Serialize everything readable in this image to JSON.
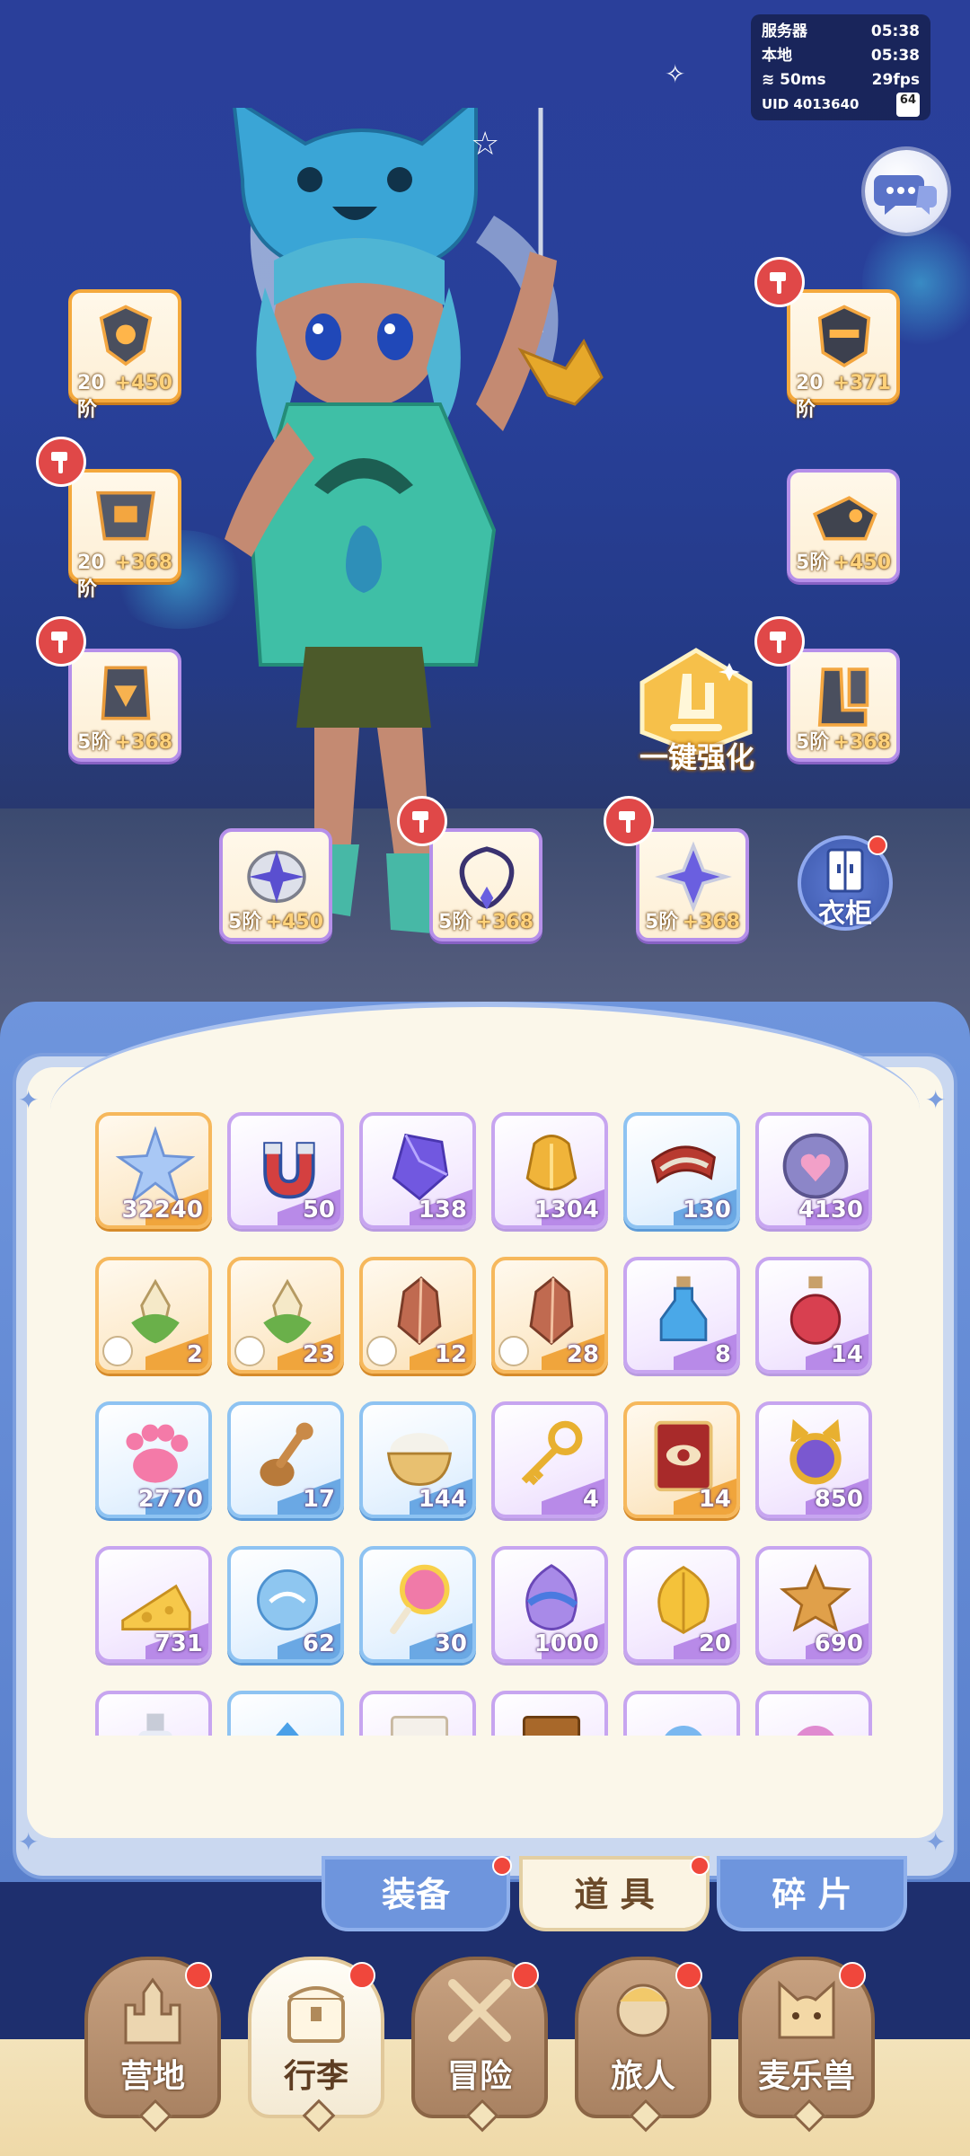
{
  "status": {
    "server_label": "服务器",
    "server_time": "05:38",
    "local_label": "本地",
    "local_time": "05:38",
    "ping": "50ms",
    "fps": "29fps",
    "uid": "UID 4013640",
    "battery": "64"
  },
  "equipment": [
    {
      "slot": "left-1",
      "tier": "20阶",
      "bonus": "+450",
      "upgradable": false
    },
    {
      "slot": "left-2",
      "tier": "20阶",
      "bonus": "+368",
      "upgradable": true
    },
    {
      "slot": "left-3",
      "tier": "5阶",
      "bonus": "+368",
      "upgradable": true
    },
    {
      "slot": "bottom-1",
      "tier": "5阶",
      "bonus": "+450",
      "upgradable": false
    },
    {
      "slot": "bottom-2",
      "tier": "5阶",
      "bonus": "+368",
      "upgradable": true
    },
    {
      "slot": "bottom-3",
      "tier": "5阶",
      "bonus": "+368",
      "upgradable": true
    },
    {
      "slot": "right-1",
      "tier": "20阶",
      "bonus": "+371",
      "upgradable": true
    },
    {
      "slot": "right-2",
      "tier": "5阶",
      "bonus": "+450",
      "upgradable": false
    },
    {
      "slot": "right-3",
      "tier": "5阶",
      "bonus": "+368",
      "upgradable": true
    }
  ],
  "one_key_strengthen": "一键强化",
  "wardrobe": "衣柜",
  "inventory": [
    {
      "icon": "star-crystal-icon",
      "count": "32240",
      "rarity": "orange"
    },
    {
      "icon": "magnet-icon",
      "count": "50",
      "rarity": "purple"
    },
    {
      "icon": "purple-gem-icon",
      "count": "138",
      "rarity": "purple"
    },
    {
      "icon": "golden-armor-icon",
      "count": "1304",
      "rarity": "purple"
    },
    {
      "icon": "red-scarf-icon",
      "count": "130",
      "rarity": "blue"
    },
    {
      "icon": "heart-coin-icon",
      "count": "4130",
      "rarity": "purple"
    },
    {
      "icon": "green-crystal-icon",
      "count": "2",
      "rarity": "orange"
    },
    {
      "icon": "green-crystal-icon",
      "count": "23",
      "rarity": "orange"
    },
    {
      "icon": "red-ore-icon",
      "count": "12",
      "rarity": "orange"
    },
    {
      "icon": "red-ore-icon",
      "count": "28",
      "rarity": "orange"
    },
    {
      "icon": "blue-potion-icon",
      "count": "8",
      "rarity": "purple"
    },
    {
      "icon": "red-potion-icon",
      "count": "14",
      "rarity": "purple"
    },
    {
      "icon": "paw-icon",
      "count": "2770",
      "rarity": "blue"
    },
    {
      "icon": "spoon-icon",
      "count": "17",
      "rarity": "blue"
    },
    {
      "icon": "rice-bowl-icon",
      "count": "144",
      "rarity": "blue"
    },
    {
      "icon": "golden-key-icon",
      "count": "4",
      "rarity": "purple"
    },
    {
      "icon": "red-card-icon",
      "count": "14",
      "rarity": "orange"
    },
    {
      "icon": "cat-mirror-icon",
      "count": "850",
      "rarity": "purple"
    },
    {
      "icon": "cheese-icon",
      "count": "731",
      "rarity": "purple"
    },
    {
      "icon": "water-orb-icon",
      "count": "62",
      "rarity": "blue"
    },
    {
      "icon": "lollipop-icon",
      "count": "30",
      "rarity": "blue"
    },
    {
      "icon": "purple-seed-icon",
      "count": "1000",
      "rarity": "purple"
    },
    {
      "icon": "golden-leaf-icon",
      "count": "20",
      "rarity": "purple"
    },
    {
      "icon": "star-cookie-icon",
      "count": "690",
      "rarity": "purple"
    },
    {
      "icon": "bottle-icon",
      "count": "",
      "rarity": "purple"
    },
    {
      "icon": "blue-crystal-icon",
      "count": "",
      "rarity": "blue"
    },
    {
      "icon": "ticket-icon",
      "count": "",
      "rarity": "purple"
    },
    {
      "icon": "book-icon",
      "count": "",
      "rarity": "purple"
    },
    {
      "icon": "blue-flower-icon",
      "count": "",
      "rarity": "purple"
    },
    {
      "icon": "pink-flower-icon",
      "count": "",
      "rarity": "purple"
    }
  ],
  "tabs": {
    "equip": "装备",
    "items": "道 具",
    "fragments": "碎 片",
    "active": "items"
  },
  "nav": [
    {
      "label": "营地",
      "icon": "castle-icon",
      "active": false
    },
    {
      "label": "行李",
      "icon": "chest-icon",
      "active": true
    },
    {
      "label": "冒险",
      "icon": "crossed-swords-icon",
      "active": false
    },
    {
      "label": "旅人",
      "icon": "traveler-icon",
      "active": false
    },
    {
      "label": "麦乐兽",
      "icon": "cat-icon",
      "active": false
    }
  ]
}
